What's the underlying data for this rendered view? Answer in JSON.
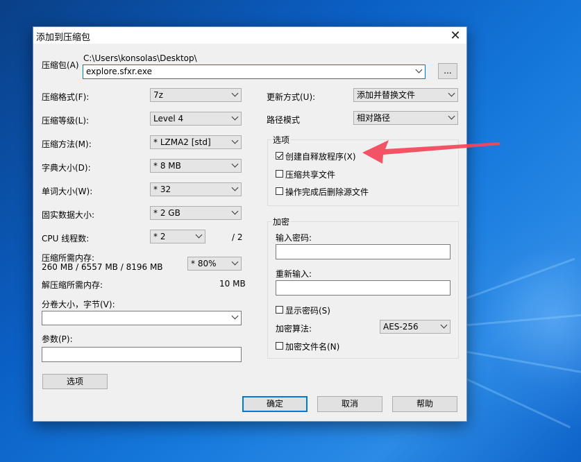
{
  "dialog": {
    "title": "添加到压缩包",
    "close_glyph": "✕"
  },
  "archive": {
    "label": "压缩包(A)",
    "path": "C:\\Users\\konsolas\\Desktop\\",
    "filename": "explore.sfxr.exe",
    "browse_label": "..."
  },
  "left": {
    "format": {
      "label": "压缩格式(F):",
      "value": "7z"
    },
    "level": {
      "label": "压缩等级(L):",
      "value": "Level 4"
    },
    "method": {
      "label": "压缩方法(M):",
      "value": "*  LZMA2 [std]"
    },
    "dict": {
      "label": "字典大小(D):",
      "value": "*  8 MB"
    },
    "word": {
      "label": "单词大小(W):",
      "value": "*  32"
    },
    "solid": {
      "label": "固实数据大小:",
      "value": "*  2 GB"
    },
    "cpu": {
      "label": "CPU 线程数:",
      "value": "*  2",
      "total": "/ 2"
    },
    "mem_compress": {
      "label": "压缩所需内存:",
      "detail": "260 MB / 6557 MB / 8196 MB",
      "value": "* 80%"
    },
    "mem_decompress": {
      "label": "解压缩所需内存:",
      "value": "10 MB"
    },
    "volume": {
      "label": "分卷大小，字节(V):",
      "value": ""
    },
    "params": {
      "label": "参数(P):",
      "value": ""
    },
    "options_button": "选项"
  },
  "right": {
    "update": {
      "label": "更新方式(U):",
      "value": "添加并替换文件"
    },
    "pathmode": {
      "label": "路径模式",
      "value": "相对路径"
    },
    "options_group": {
      "title": "选项",
      "items": [
        {
          "label": "创建自释放程序(X)",
          "checked": true
        },
        {
          "label": "压缩共享文件",
          "checked": false
        },
        {
          "label": "操作完成后删除源文件",
          "checked": false
        }
      ]
    },
    "encryption": {
      "title": "加密",
      "password_label": "输入密码:",
      "reenter_label": "重新输入:",
      "show_password": "显示密码(S)",
      "method_label": "加密算法:",
      "method_value": "AES-256",
      "encrypt_names": "加密文件名(N)"
    }
  },
  "buttons": {
    "ok": "确定",
    "cancel": "取消",
    "help": "帮助"
  },
  "colors": {
    "accent": "#0078d7",
    "arrow": "#f2475a"
  }
}
